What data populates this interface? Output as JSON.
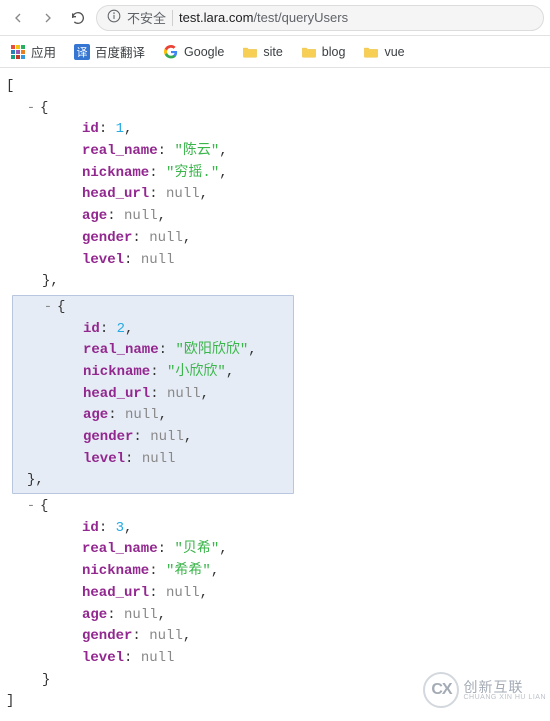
{
  "browser": {
    "insecure_label": "不安全",
    "url_host": "test.lara.com",
    "url_path": "/test/queryUsers"
  },
  "bookmarks": {
    "apps": "应用",
    "baidu_icon": "译",
    "baidu": "百度翻译",
    "google": "Google",
    "site": "site",
    "blog": "blog",
    "vue": "vue"
  },
  "json": {
    "open_bracket": "[",
    "close_bracket": "]",
    "collapse": "-",
    "brace_open": "{",
    "brace_close_comma": "},",
    "brace_close": "}",
    "keys": {
      "id": "id",
      "real_name": "real_name",
      "nickname": "nickname",
      "head_url": "head_url",
      "age": "age",
      "gender": "gender",
      "level": "level"
    },
    "null_label": "null",
    "rows": [
      {
        "id": "1",
        "real_name": "\"陈云\"",
        "nickname": "\"穷摇.\""
      },
      {
        "id": "2",
        "real_name": "\"欧阳欣欣\"",
        "nickname": "\"小欣欣\""
      },
      {
        "id": "3",
        "real_name": "\"贝希\"",
        "nickname": "\"希希\""
      }
    ]
  },
  "watermark": {
    "logo": "CX",
    "cn": "创新互联",
    "py": "CHUANG XIN HU LIAN"
  }
}
